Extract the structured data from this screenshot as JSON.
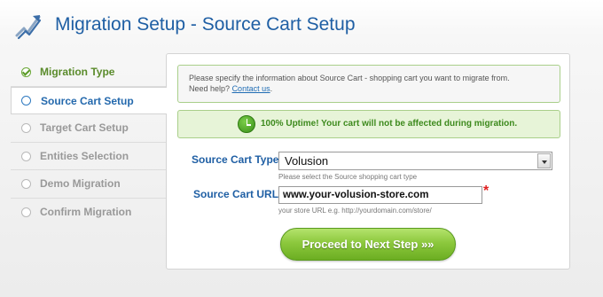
{
  "header": {
    "title": "Migration Setup - Source Cart Setup"
  },
  "sidebar": {
    "items": [
      {
        "label": "Migration Type",
        "state": "done"
      },
      {
        "label": "Source Cart Setup",
        "state": "active"
      },
      {
        "label": "Target Cart Setup",
        "state": "pending"
      },
      {
        "label": "Entities Selection",
        "state": "pending"
      },
      {
        "label": "Demo Migration",
        "state": "pending"
      },
      {
        "label": "Confirm Migration",
        "state": "pending"
      }
    ]
  },
  "info": {
    "text": "Please specify the information about Source Cart - shopping cart you want to migrate from.",
    "help_prefix": "Need help?",
    "help_link": "Contact us",
    "help_suffix": "."
  },
  "uptime": {
    "text": "100% Uptime! Your cart will not be affected during migration."
  },
  "form": {
    "cart_type_label": "Source Cart Type:",
    "cart_type_value": "Volusion",
    "cart_type_hint": "Please select the Source shopping cart type",
    "cart_url_label": "Source Cart URL:",
    "cart_url_value": "www.your-volusion-store.com",
    "cart_url_hint": "your store URL e.g. http://yourdomain.com/store/",
    "required_mark": "*"
  },
  "actions": {
    "proceed_label": "Proceed to Next Step »»"
  },
  "colors": {
    "title_blue": "#1f5fa4",
    "done_green": "#5a8b2b",
    "button_green": "#8cc83d",
    "required_red": "#e02020"
  }
}
